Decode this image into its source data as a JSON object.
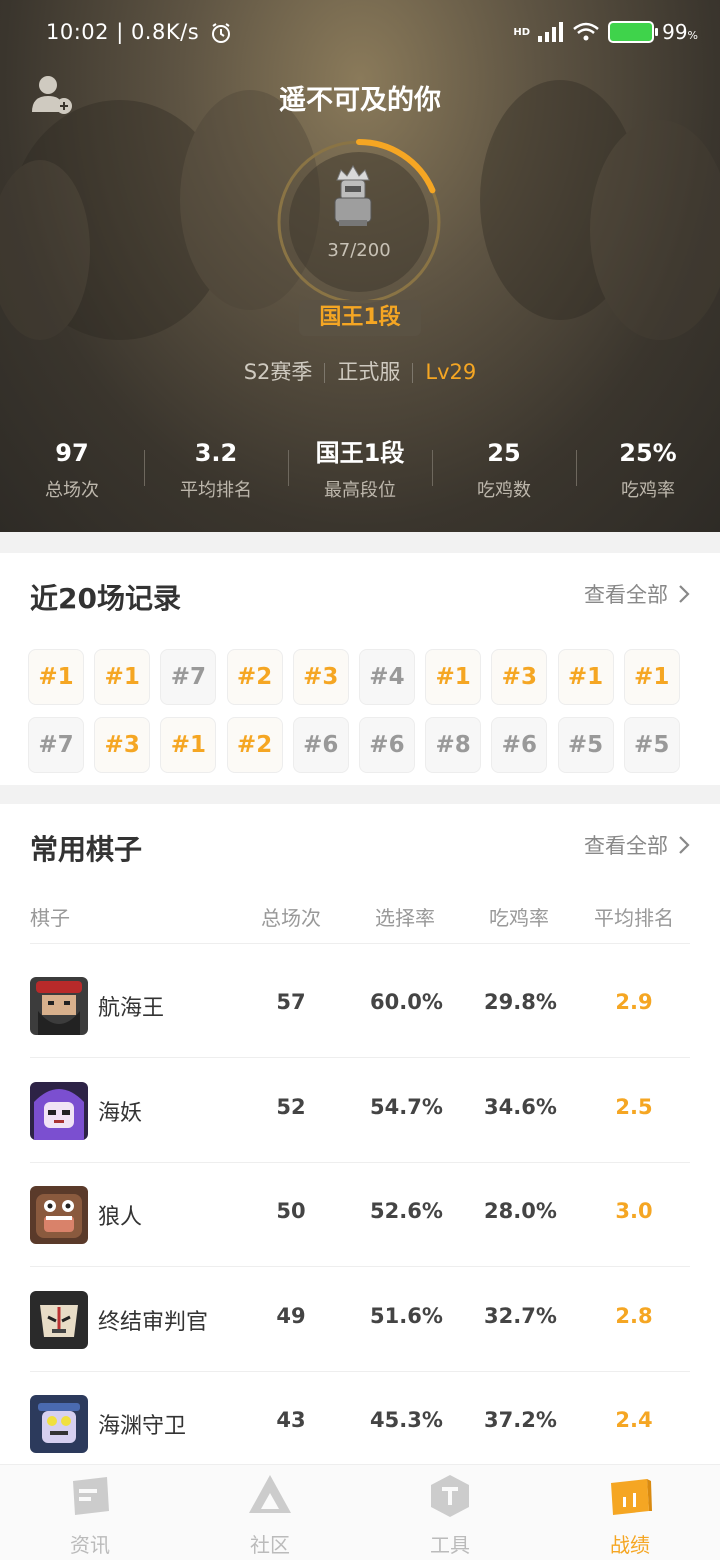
{
  "status_bar": {
    "time_speed": "10:02 | 0.8K/s",
    "battery": "99",
    "battery_unit": "%",
    "network": "HD"
  },
  "profile": {
    "nickname": "遥不可及的你",
    "rank_progress": "37/200",
    "rank_progress_fraction": 0.185,
    "rank_badge": "国王1段",
    "season": "S2赛季",
    "server": "正式服",
    "level": "Lv29"
  },
  "stats": [
    {
      "value": "97",
      "label": "总场次"
    },
    {
      "value": "3.2",
      "label": "平均排名"
    },
    {
      "value": "国王1段",
      "label": "最高段位"
    },
    {
      "value": "25",
      "label": "吃鸡数"
    },
    {
      "value": "25%",
      "label": "吃鸡率"
    }
  ],
  "recent": {
    "title": "近20场记录",
    "view_all": "查看全部",
    "matches": [
      "#1",
      "#1",
      "#7",
      "#2",
      "#3",
      "#4",
      "#1",
      "#3",
      "#1",
      "#1",
      "#7",
      "#3",
      "#1",
      "#2",
      "#6",
      "#6",
      "#8",
      "#6",
      "#5",
      "#5"
    ]
  },
  "pieces": {
    "title": "常用棋子",
    "view_all": "查看全部",
    "headers": {
      "name": "棋子",
      "games": "总场次",
      "pick": "选择率",
      "win": "吃鸡率",
      "rank": "平均排名"
    },
    "rows": [
      {
        "name": "航海王",
        "games": "57",
        "pick": "60.0%",
        "win": "29.8%",
        "rank": "2.9",
        "avatar_icon": "pirate-king-avatar"
      },
      {
        "name": "海妖",
        "games": "52",
        "pick": "54.7%",
        "win": "34.6%",
        "rank": "2.5",
        "avatar_icon": "sea-siren-avatar"
      },
      {
        "name": "狼人",
        "games": "50",
        "pick": "52.6%",
        "win": "28.0%",
        "rank": "3.0",
        "avatar_icon": "werewolf-avatar"
      },
      {
        "name": "终结审判官",
        "games": "49",
        "pick": "51.6%",
        "win": "32.7%",
        "rank": "2.8",
        "avatar_icon": "doom-arbiter-avatar"
      },
      {
        "name": "海渊守卫",
        "games": "43",
        "pick": "45.3%",
        "win": "37.2%",
        "rank": "2.4",
        "avatar_icon": "abyss-guard-avatar"
      }
    ]
  },
  "nav": [
    {
      "label": "资讯",
      "icon": "news-icon",
      "active": false
    },
    {
      "label": "社区",
      "icon": "community-icon",
      "active": false
    },
    {
      "label": "工具",
      "icon": "tools-icon",
      "active": false
    },
    {
      "label": "战绩",
      "icon": "record-icon",
      "active": true
    }
  ],
  "colors": {
    "accent": "#f5a623",
    "header_bg": "#3a352d"
  }
}
